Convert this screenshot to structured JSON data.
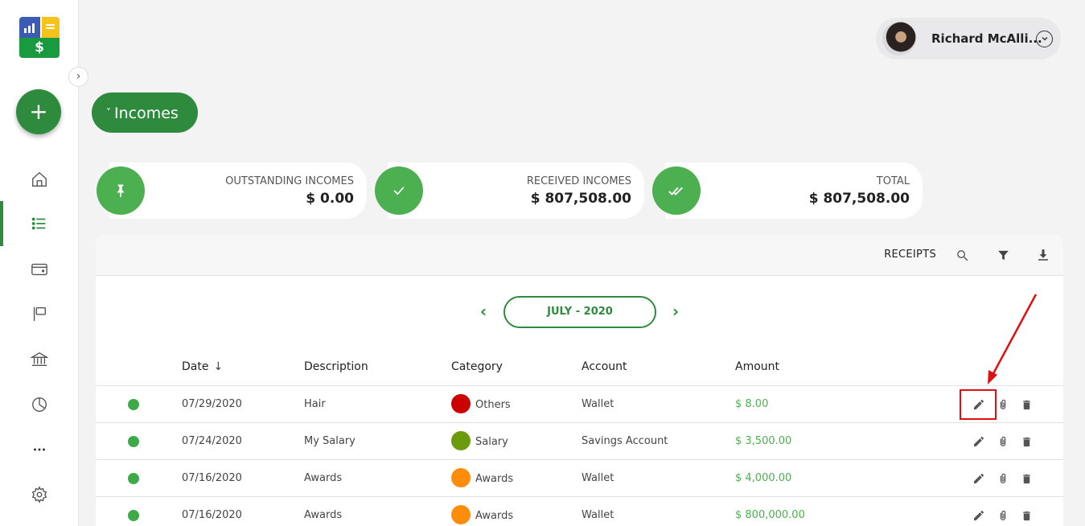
{
  "user": {
    "name": "Richard McAlli..."
  },
  "sidebar": {
    "logo_symbol": "$",
    "add_icon": "+",
    "collapse_icon": "›",
    "nav_items": [
      "home-icon",
      "list-icon",
      "wallet-icon",
      "flag-icon",
      "bank-icon",
      "pie-chart-icon",
      "more-icon",
      "settings-icon"
    ],
    "active_item": "list-icon"
  },
  "page": {
    "section_title": "Incomes",
    "section_chevron": "˅"
  },
  "stats": [
    {
      "label": "OUTSTANDING INCOMES",
      "value": "$ 0.00",
      "icon": "pin-icon"
    },
    {
      "label": "RECEIVED INCOMES",
      "value": "$ 807,508.00",
      "icon": "check-icon"
    },
    {
      "label": "TOTAL",
      "value": "$ 807,508.00",
      "icon": "double-check-icon"
    }
  ],
  "toolbar": {
    "receipts_label": "RECEIPTS"
  },
  "month": {
    "label": "JULY - 2020",
    "prev": "‹",
    "next": "›"
  },
  "table": {
    "headers": {
      "date": "Date",
      "description": "Description",
      "category": "Category",
      "account": "Account",
      "amount": "Amount"
    },
    "sort_arrow": "↓",
    "rows": [
      {
        "date": "07/29/2020",
        "description": "Hair",
        "category": "Others",
        "category_color": "#cc0000",
        "account": "Wallet",
        "amount": "$ 8.00"
      },
      {
        "date": "07/24/2020",
        "description": "My Salary",
        "category": "Salary",
        "category_color": "#6b9a0a",
        "account": "Savings Account",
        "amount": "$ 3,500.00"
      },
      {
        "date": "07/16/2020",
        "description": "Awards",
        "category": "Awards",
        "category_color": "#ff8c0a",
        "account": "Wallet",
        "amount": "$ 4,000.00"
      },
      {
        "date": "07/16/2020",
        "description": "Awards",
        "category": "Awards",
        "category_color": "#ff8c0a",
        "account": "Wallet",
        "amount": "$ 800,000.00"
      }
    ]
  },
  "colors": {
    "accent": "#2e8b3e",
    "stat_circle": "#4caf50",
    "paid_dot": "#3daa4a",
    "annotation": "#e01010"
  }
}
